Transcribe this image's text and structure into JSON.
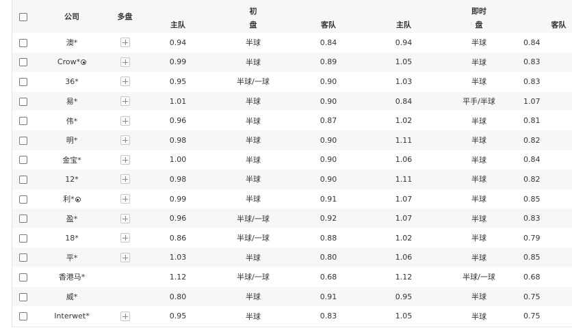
{
  "header": {
    "company": "公司",
    "multi": "多盘",
    "initial": "初",
    "live": "即时",
    "home": "主队",
    "handicap": "盘",
    "away": "客队"
  },
  "rows": [
    {
      "company": "澳*",
      "ball": false,
      "plus": true,
      "i_home": "0.94",
      "i_line": "半球",
      "i_away": "0.84",
      "l_home": "0.94",
      "l_line": "半球",
      "l_away": "0.84"
    },
    {
      "company": "Crow*",
      "ball": true,
      "plus": true,
      "i_home": "0.99",
      "i_line": "半球",
      "i_away": "0.89",
      "l_home": "1.05",
      "l_line": "半球",
      "l_away": "0.83"
    },
    {
      "company": "36*",
      "ball": false,
      "plus": true,
      "i_home": "0.95",
      "i_line": "半球/一球",
      "i_away": "0.90",
      "l_home": "1.03",
      "l_line": "半球",
      "l_away": "0.83"
    },
    {
      "company": "易*",
      "ball": false,
      "plus": true,
      "i_home": "1.01",
      "i_line": "半球",
      "i_away": "0.90",
      "l_home": "0.84",
      "l_line": "平手/半球",
      "l_away": "1.07"
    },
    {
      "company": "伟*",
      "ball": false,
      "plus": true,
      "i_home": "0.96",
      "i_line": "半球",
      "i_away": "0.87",
      "l_home": "1.02",
      "l_line": "半球",
      "l_away": "0.81"
    },
    {
      "company": "明*",
      "ball": false,
      "plus": true,
      "i_home": "0.98",
      "i_line": "半球",
      "i_away": "0.90",
      "l_home": "1.11",
      "l_line": "半球",
      "l_away": "0.82"
    },
    {
      "company": "金宝*",
      "ball": false,
      "plus": true,
      "i_home": "1.00",
      "i_line": "半球",
      "i_away": "0.90",
      "l_home": "1.06",
      "l_line": "半球",
      "l_away": "0.84"
    },
    {
      "company": "12*",
      "ball": false,
      "plus": true,
      "i_home": "0.98",
      "i_line": "半球",
      "i_away": "0.90",
      "l_home": "1.11",
      "l_line": "半球",
      "l_away": "0.82"
    },
    {
      "company": "利*",
      "ball": true,
      "plus": true,
      "i_home": "0.99",
      "i_line": "半球",
      "i_away": "0.91",
      "l_home": "1.07",
      "l_line": "半球",
      "l_away": "0.85"
    },
    {
      "company": "盈*",
      "ball": false,
      "plus": true,
      "i_home": "0.96",
      "i_line": "半球/一球",
      "i_away": "0.92",
      "l_home": "1.07",
      "l_line": "半球",
      "l_away": "0.83"
    },
    {
      "company": "18*",
      "ball": false,
      "plus": true,
      "i_home": "0.86",
      "i_line": "半球/一球",
      "i_away": "0.88",
      "l_home": "1.02",
      "l_line": "半球",
      "l_away": "0.79"
    },
    {
      "company": "平*",
      "ball": false,
      "plus": true,
      "i_home": "1.03",
      "i_line": "半球",
      "i_away": "0.80",
      "l_home": "1.06",
      "l_line": "半球",
      "l_away": "0.85"
    },
    {
      "company": "香港马*",
      "ball": false,
      "plus": false,
      "i_home": "1.12",
      "i_line": "半球/一球",
      "i_away": "0.68",
      "l_home": "1.12",
      "l_line": "半球/一球",
      "l_away": "0.68"
    },
    {
      "company": "威*",
      "ball": false,
      "plus": false,
      "i_home": "0.80",
      "i_line": "半球",
      "i_away": "0.91",
      "l_home": "0.95",
      "l_line": "半球",
      "l_away": "0.75"
    },
    {
      "company": "Interwet*",
      "ball": false,
      "plus": true,
      "i_home": "0.95",
      "i_line": "半球",
      "i_away": "0.83",
      "l_home": "1.05",
      "l_line": "半球",
      "l_away": "0.75"
    }
  ]
}
